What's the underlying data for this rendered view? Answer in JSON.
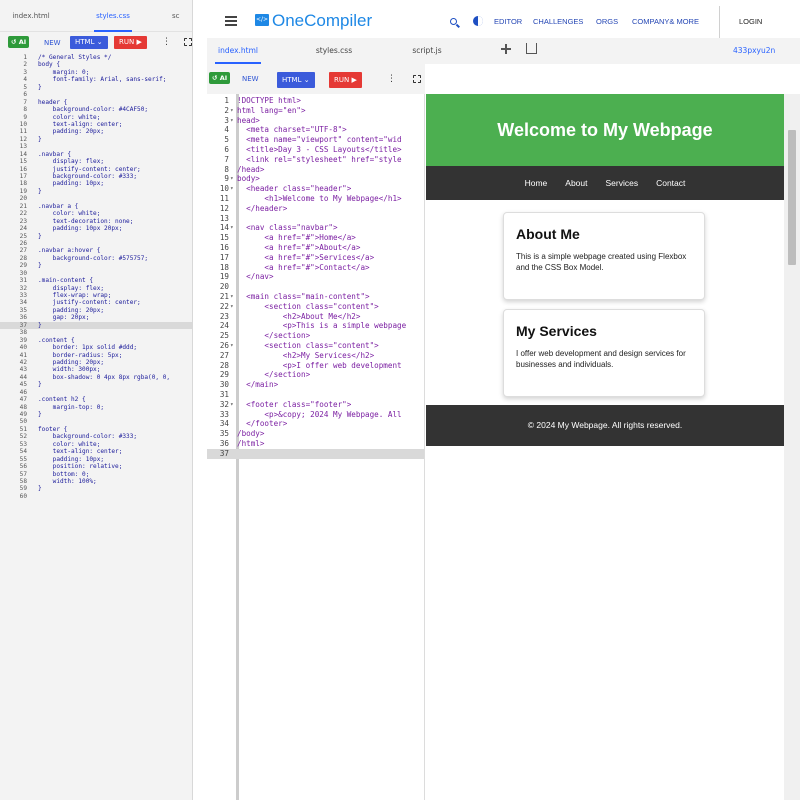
{
  "left_panel": {
    "tabs": [
      {
        "label": "index.html",
        "active": false
      },
      {
        "label": "styles.css",
        "active": true
      },
      {
        "label": "sc",
        "active": false
      }
    ],
    "toolbar": {
      "ai_label": "AI",
      "new_label": "NEW",
      "lang_label": "HTML",
      "run_label": "RUN"
    },
    "highlight_line": 37,
    "code_lines": [
      "/* General Styles */",
      "body {",
      "    margin: 0;",
      "    font-family: Arial, sans-serif;",
      "}",
      "",
      "header {",
      "    background-color: #4CAF50;",
      "    color: white;",
      "    text-align: center;",
      "    padding: 20px;",
      "}",
      "",
      ".navbar {",
      "    display: flex;",
      "    justify-content: center;",
      "    background-color: #333;",
      "    padding: 10px;",
      "}",
      "",
      ".navbar a {",
      "    color: white;",
      "    text-decoration: none;",
      "    padding: 10px 20px;",
      "}",
      "",
      ".navbar a:hover {",
      "    background-color: #575757;",
      "}",
      "",
      ".main-content {",
      "    display: flex;",
      "    flex-wrap: wrap;",
      "    justify-content: center;",
      "    padding: 20px;",
      "    gap: 20px;",
      "}",
      "",
      ".content {",
      "    border: 1px solid #ddd;",
      "    border-radius: 5px;",
      "    padding: 20px;",
      "    width: 300px;",
      "    box-shadow: 0 4px 8px rgba(0, 0,",
      "}",
      "",
      ".content h2 {",
      "    margin-top: 0;",
      "}",
      "",
      "footer {",
      "    background-color: #333;",
      "    color: white;",
      "    text-align: center;",
      "    padding: 10px;",
      "    position: relative;",
      "    bottom: 0;",
      "    width: 100%;",
      "}",
      ""
    ]
  },
  "topbar": {
    "logo_text": "</>",
    "brand": "OneCompiler",
    "nav": [
      "EDITOR",
      "CHALLENGES",
      "ORGS",
      "COMPANY& MORE"
    ],
    "login": "LOGIN"
  },
  "tabs": {
    "files": [
      {
        "label": "index.html",
        "active": true
      },
      {
        "label": "styles.css",
        "active": false
      },
      {
        "label": "script.js",
        "active": false
      }
    ],
    "session_id": "433pxyu2n"
  },
  "toolbar": {
    "ai_label": "AI",
    "new_label": "NEW",
    "lang_label": "HTML",
    "run_label": "RUN"
  },
  "editor": {
    "highlight_line": 37,
    "code_lines": [
      "!DOCTYPE html>",
      "html lang=\"en\">",
      "head>",
      "  <meta charset=\"UTF-8\">",
      "  <meta name=\"viewport\" content=\"wid",
      "  <title>Day 3 - CSS Layouts</title>",
      "  <link rel=\"stylesheet\" href=\"style",
      "/head>",
      "body>",
      "  <header class=\"header\">",
      "      <h1>Welcome to My Webpage</h1>",
      "  </header>",
      "",
      "  <nav class=\"navbar\">",
      "      <a href=\"#\">Home</a>",
      "      <a href=\"#\">About</a>",
      "      <a href=\"#\">Services</a>",
      "      <a href=\"#\">Contact</a>",
      "  </nav>",
      "",
      "  <main class=\"main-content\">",
      "      <section class=\"content\">",
      "          <h2>About Me</h2>",
      "          <p>This is a simple webpage",
      "      </section>",
      "      <section class=\"content\">",
      "          <h2>My Services</h2>",
      "          <p>I offer web development",
      "      </section>",
      "  </main>",
      "",
      "  <footer class=\"footer\">",
      "      <p>&copy; 2024 My Webpage. All",
      "  </footer>",
      "/body>",
      "/html>",
      ""
    ],
    "folds": [
      2,
      3,
      9,
      10,
      14,
      21,
      22,
      26,
      32
    ]
  },
  "preview": {
    "header_title": "Welcome to My Webpage",
    "nav_links": [
      "Home",
      "About",
      "Services",
      "Contact"
    ],
    "cards": [
      {
        "title": "About Me",
        "text": "This is a simple webpage created using Flexbox and the CSS Box Model."
      },
      {
        "title": "My Services",
        "text": "I offer web development and design services for businesses and individuals."
      }
    ],
    "footer": "© 2024 My Webpage. All rights reserved.",
    "colors": {
      "header_bg": "#4caf50",
      "nav_bg": "#333333",
      "footer_bg": "#333333"
    }
  }
}
